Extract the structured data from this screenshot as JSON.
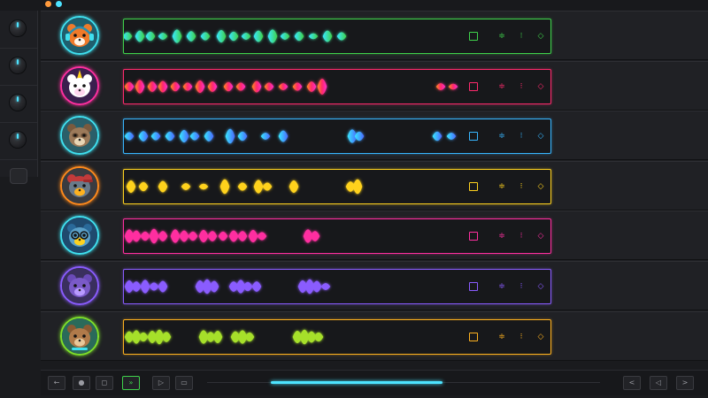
{
  "window": {
    "dot_colors": [
      "#ff9a3c",
      "#4de3ff"
    ]
  },
  "tracks": [
    {
      "animal": "fox",
      "avatar_ring": "#3fe0f0",
      "accent": "#3fd14b",
      "wave_colors": [
        "#38e8ff",
        "#3fd14b"
      ],
      "controls": [
        {
          "icon": "square-icon"
        },
        {
          "icon": "equalizer-icon",
          "glyph": "≑"
        },
        {
          "icon": "dots-icon",
          "glyph": "⁝"
        },
        {
          "icon": "diamond-icon",
          "glyph": "◇"
        }
      ]
    },
    {
      "animal": "unicorn",
      "avatar_ring": "#ff2fa0",
      "accent": "#ff2a6d",
      "wave_colors": [
        "#ff8a1c",
        "#ff2a6d",
        "#ff2fc8"
      ],
      "controls": [
        {
          "icon": "square-icon"
        },
        {
          "icon": "equalizer-icon",
          "glyph": "≑"
        },
        {
          "icon": "dots-icon",
          "glyph": "⁝"
        },
        {
          "icon": "diamond-icon",
          "glyph": "◇"
        }
      ]
    },
    {
      "animal": "sloth",
      "avatar_ring": "#3fe0f0",
      "accent": "#38b6ff",
      "wave_colors": [
        "#38e8ff",
        "#4a6bff"
      ],
      "controls": [
        {
          "icon": "square-icon"
        },
        {
          "icon": "equalizer-icon",
          "glyph": "≑"
        },
        {
          "icon": "dots-icon",
          "glyph": "⁝"
        },
        {
          "icon": "diamond-icon",
          "glyph": "◇"
        }
      ]
    },
    {
      "animal": "duck",
      "avatar_ring": "#ff8a1c",
      "accent": "#ffd21f",
      "wave_colors": [
        "#ffd21f"
      ],
      "controls": [
        {
          "icon": "square-icon"
        },
        {
          "icon": "equalizer-icon",
          "glyph": "≑"
        },
        {
          "icon": "dots-icon",
          "glyph": "⁝"
        },
        {
          "icon": "diamond-icon",
          "glyph": "◇"
        }
      ]
    },
    {
      "animal": "owl",
      "avatar_ring": "#3fe0f0",
      "accent": "#ff2fa0",
      "wave_colors": [
        "#ff2fa0"
      ],
      "controls": [
        {
          "icon": "square-icon"
        },
        {
          "icon": "equalizer-icon",
          "glyph": "≑"
        },
        {
          "icon": "dots-icon",
          "glyph": "⁝"
        },
        {
          "icon": "diamond-icon",
          "glyph": "◇"
        }
      ]
    },
    {
      "animal": "cat",
      "avatar_ring": "#8a5cff",
      "accent": "#8a5cff",
      "wave_colors": [
        "#8a5cff"
      ],
      "controls": [
        {
          "icon": "square-icon"
        },
        {
          "icon": "equalizer-icon",
          "glyph": "≑"
        },
        {
          "icon": "dots-icon",
          "glyph": "⁝"
        },
        {
          "icon": "diamond-icon",
          "glyph": "◇"
        }
      ]
    },
    {
      "animal": "bear",
      "avatar_ring": "#7ee02a",
      "accent": "#ffb21f",
      "wave_colors": [
        "#a6e02a"
      ],
      "controls": [
        {
          "icon": "square-icon"
        },
        {
          "icon": "equalizer-icon",
          "glyph": "≑"
        },
        {
          "icon": "dots-icon",
          "glyph": "⁝"
        },
        {
          "icon": "diamond-icon",
          "glyph": "◇"
        }
      ]
    }
  ],
  "transport": {
    "left_buttons": [
      {
        "icon": "back-arrow-icon",
        "glyph": "←"
      },
      {
        "icon": "record-icon",
        "glyph": "●"
      },
      {
        "icon": "stop-icon",
        "glyph": "◻"
      },
      {
        "icon": "fast-forward-icon",
        "glyph": "»",
        "active": true
      },
      {
        "icon": "play-icon",
        "glyph": "▷"
      },
      {
        "icon": "window-icon",
        "glyph": "▭"
      }
    ],
    "right_buttons": [
      {
        "icon": "chevron-left-icon",
        "glyph": "<"
      },
      {
        "icon": "tag-icon",
        "glyph": "◁"
      },
      {
        "icon": "chevron-right-icon",
        "glyph": ">"
      }
    ],
    "progress": 0.6
  }
}
